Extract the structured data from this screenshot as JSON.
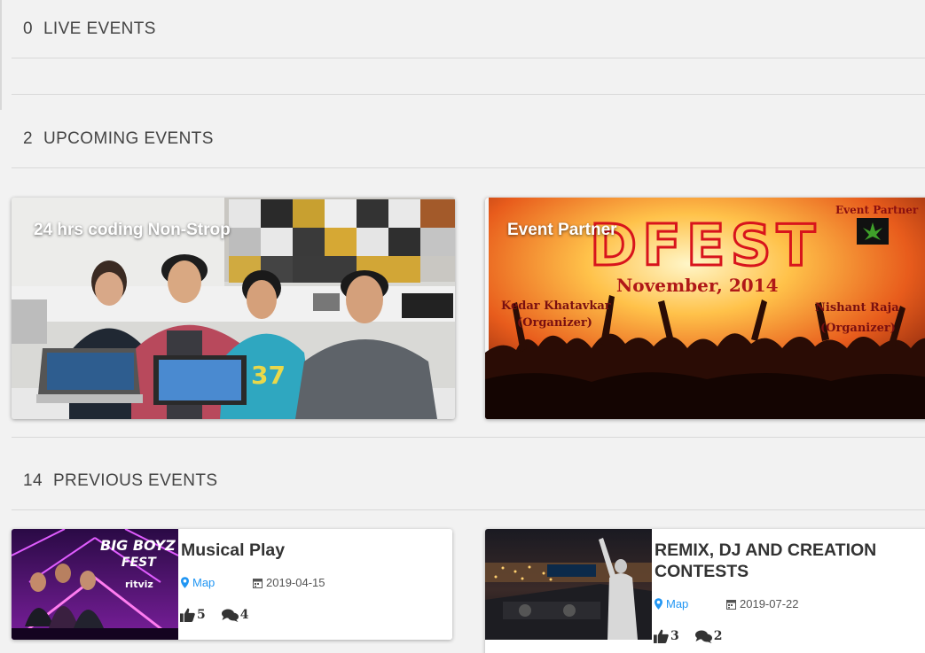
{
  "sections": {
    "live": {
      "count": "0",
      "label": "LIVE EVENTS"
    },
    "upcoming": {
      "count": "2",
      "label": "UPCOMING EVENTS"
    },
    "previous": {
      "count": "14",
      "label": "PREVIOUS EVENTS"
    }
  },
  "upcoming_events": [
    {
      "title": "24 hrs coding Non-Strop"
    },
    {
      "title": "Event Partner",
      "poster": {
        "headline": "DFEST",
        "date_text": "November, 2014",
        "partner_label": "Event Partner",
        "left_name": "Kedar Khatavkar",
        "left_role": "(Organizer)",
        "right_name": "Nishant Raja",
        "right_role": "(Organizer)"
      }
    }
  ],
  "previous_events": [
    {
      "title": "Musical Play",
      "map_label": "Map",
      "date": "2019-04-15",
      "likes": "5",
      "comments": "4",
      "poster": {
        "line1": "BIG BOYZ",
        "line2": "FEST",
        "artist": "ritviz"
      }
    },
    {
      "title": "REMIX, DJ AND CREATION CONTESTS",
      "map_label": "Map",
      "date": "2019-07-22",
      "likes": "3",
      "comments": "2"
    }
  ],
  "colors": {
    "background": "#f2f2f2",
    "accent_link": "#2196f3",
    "rule": "#d9d9d9",
    "dfest_red": "#d8141c",
    "poster_purple": "#5b1a8f"
  },
  "icons": {
    "map": "map-marker-icon",
    "date": "calendar-icon",
    "likes": "thumbs-up-icon",
    "comments": "comments-icon"
  }
}
